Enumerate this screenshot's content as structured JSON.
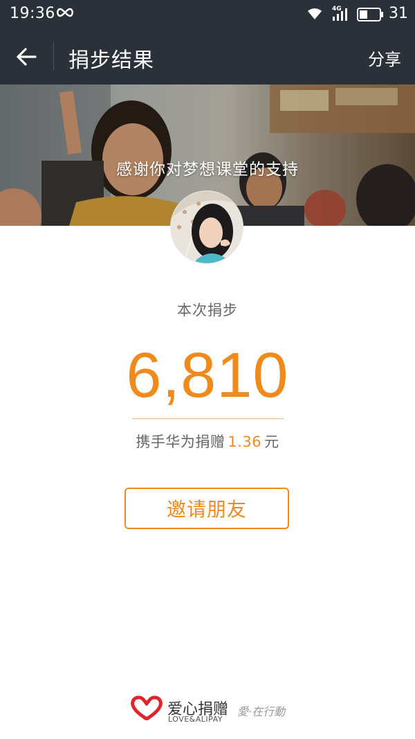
{
  "status_bar": {
    "time": "19:36",
    "network": "4G",
    "battery": "31"
  },
  "nav": {
    "title": "捐步结果",
    "share": "分享"
  },
  "banner": {
    "text": "感谢你对梦想课堂的支持"
  },
  "result": {
    "label": "本次捐步",
    "steps": "6,810",
    "donate_prefix": "携手华为捐赠",
    "donate_amount": "1.36",
    "donate_unit": "元"
  },
  "invite_button": "邀请朋友",
  "footer": {
    "brand_cn": "爱心捐赠",
    "brand_en": "LOVE&ALIPAY",
    "tagline": "愛·在行動"
  },
  "colors": {
    "accent": "#f08a1d",
    "header_bg": "#2a3138"
  },
  "icons": {
    "back": "arrow-left-icon",
    "loop": "infinity-icon",
    "wifi": "wifi-icon",
    "signal": "signal-icon",
    "battery": "battery-icon",
    "logo": "heart-logo-icon"
  }
}
